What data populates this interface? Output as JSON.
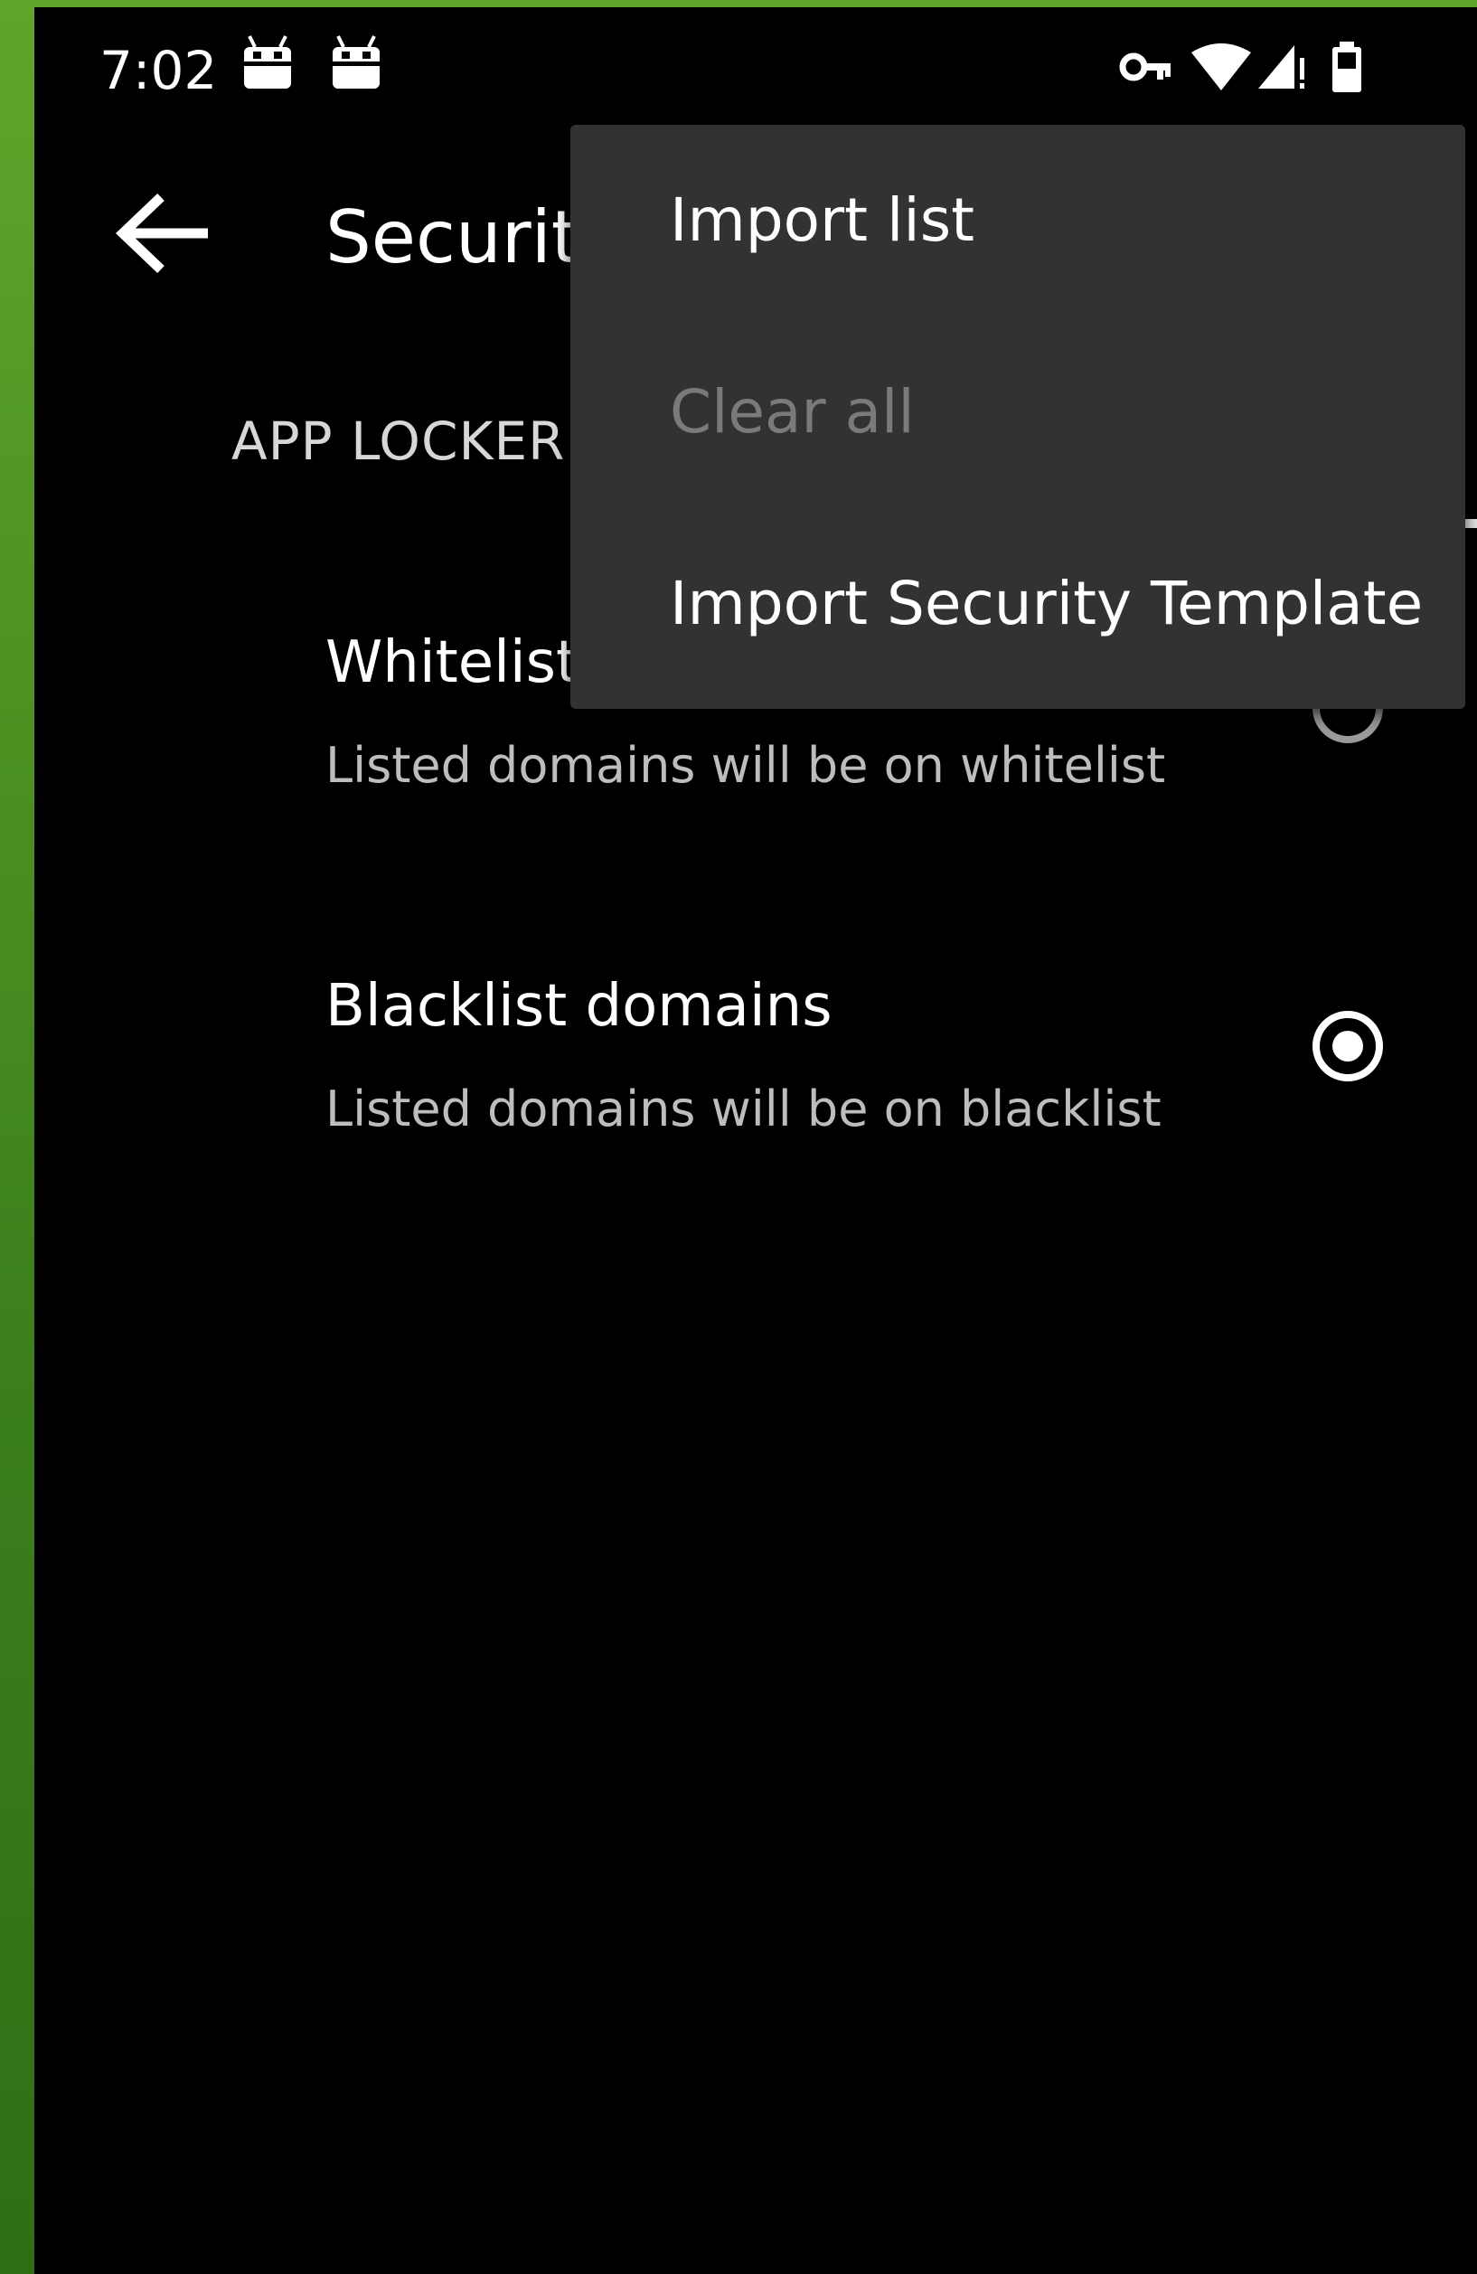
{
  "status_bar": {
    "time": "7:02",
    "icons": [
      "android-notification-icon",
      "android-notification-icon",
      "vpn-key-icon",
      "wifi-icon",
      "signal-icon",
      "battery-icon"
    ]
  },
  "app_bar": {
    "back_icon": "arrow-left-icon",
    "title": "Securit"
  },
  "tabs": {
    "active_label": "APP LOCKER"
  },
  "options": [
    {
      "title": "Whitelist",
      "subtitle": "Listed domains will be on whitelist",
      "selected": false
    },
    {
      "title": "Blacklist domains",
      "subtitle": "Listed domains will be on blacklist",
      "selected": true
    }
  ],
  "overflow_menu": {
    "items": [
      {
        "label": "Import list",
        "enabled": true
      },
      {
        "label": "Clear all",
        "enabled": false
      },
      {
        "label": "Import Security Template",
        "enabled": true
      }
    ]
  },
  "colors": {
    "background": "#000000",
    "menu_background": "#323232",
    "frame_green": "#3f8a1e",
    "disabled_text": "#7a7a7a"
  }
}
